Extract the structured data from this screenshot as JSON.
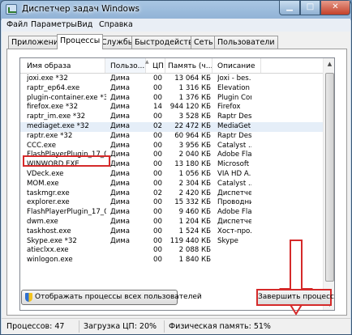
{
  "window": {
    "title": "Диспетчер задач Windows"
  },
  "menu": [
    "Файл",
    "Параметры",
    "Вид",
    "Справка"
  ],
  "tabs": [
    "Приложения",
    "Процессы",
    "Службы",
    "Быстродействие",
    "Сеть",
    "Пользователи"
  ],
  "active_tab": "Процессы",
  "columns": [
    "Имя образа",
    "Пользо...",
    "ЦП",
    "Память (ч...",
    "Описание"
  ],
  "processes": [
    {
      "name": "joxi.exe *32",
      "user": "Дима",
      "cpu": "00",
      "mem": "13 064 КБ",
      "desc": "Joxi - bes..."
    },
    {
      "name": "raptr_ep64.exe",
      "user": "Дима",
      "cpu": "00",
      "mem": "1 316 КБ",
      "desc": "Elevation ..."
    },
    {
      "name": "plugin-container.exe *32",
      "user": "Дима",
      "cpu": "00",
      "mem": "1 376 КБ",
      "desc": "Plugin Cont..."
    },
    {
      "name": "firefox.exe *32",
      "user": "Дима",
      "cpu": "14",
      "mem": "944 120 КБ",
      "desc": "Firefox"
    },
    {
      "name": "raptr_im.exe *32",
      "user": "Дима",
      "cpu": "00",
      "mem": "3 528 КБ",
      "desc": "Raptr Des..."
    },
    {
      "name": "mediaget.exe *32",
      "user": "Дима",
      "cpu": "02",
      "mem": "22 472 КБ",
      "desc": "MediaGet ..."
    },
    {
      "name": "raptr.exe *32",
      "user": "Дима",
      "cpu": "00",
      "mem": "60 964 КБ",
      "desc": "Raptr Des..."
    },
    {
      "name": "CCC.exe",
      "user": "Дима",
      "cpu": "00",
      "mem": "3 956 КБ",
      "desc": "Catalyst ..."
    },
    {
      "name": "FlashPlayerPlugin_17_0...",
      "user": "Дима",
      "cpu": "00",
      "mem": "2 040 КБ",
      "desc": "Adobe Fla..."
    },
    {
      "name": "WINWORD.EXE",
      "user": "Дима",
      "cpu": "00",
      "mem": "13 180 КБ",
      "desc": "Microsoft ..."
    },
    {
      "name": "VDeck.exe",
      "user": "Дима",
      "cpu": "00",
      "mem": "1 056 КБ",
      "desc": "VIA HD A..."
    },
    {
      "name": "MOM.exe",
      "user": "Дима",
      "cpu": "00",
      "mem": "2 304 КБ",
      "desc": "Catalyst ..."
    },
    {
      "name": "taskmgr.exe",
      "user": "Дима",
      "cpu": "02",
      "mem": "2 420 КБ",
      "desc": "Диспетче..."
    },
    {
      "name": "explorer.exe",
      "user": "Дима",
      "cpu": "00",
      "mem": "15 332 КБ",
      "desc": "Проводник"
    },
    {
      "name": "FlashPlayerPlugin_17_0...",
      "user": "Дима",
      "cpu": "00",
      "mem": "9 460 КБ",
      "desc": "Adobe Fla..."
    },
    {
      "name": "dwm.exe",
      "user": "Дима",
      "cpu": "00",
      "mem": "1 204 КБ",
      "desc": "Диспетче..."
    },
    {
      "name": "taskhost.exe",
      "user": "Дима",
      "cpu": "00",
      "mem": "1 524 КБ",
      "desc": "Хост-про..."
    },
    {
      "name": "Skype.exe *32",
      "user": "Дима",
      "cpu": "00",
      "mem": "119 440 КБ",
      "desc": "Skype"
    },
    {
      "name": "atieclxx.exe",
      "user": "",
      "cpu": "00",
      "mem": "2 088 КБ",
      "desc": ""
    },
    {
      "name": "winlogon.exe",
      "user": "",
      "cpu": "00",
      "mem": "1 840 КБ",
      "desc": ""
    }
  ],
  "buttons": {
    "show_all": "Отображать процессы всех пользователей",
    "end_process": "Завершить процесс"
  },
  "status": {
    "processes": "Процессов: 47",
    "cpu": "Загрузка ЦП: 20%",
    "memory": "Физическая память: 51%"
  },
  "colors": {
    "highlight": "#d52a2a",
    "arrow": "#d52a2a"
  }
}
